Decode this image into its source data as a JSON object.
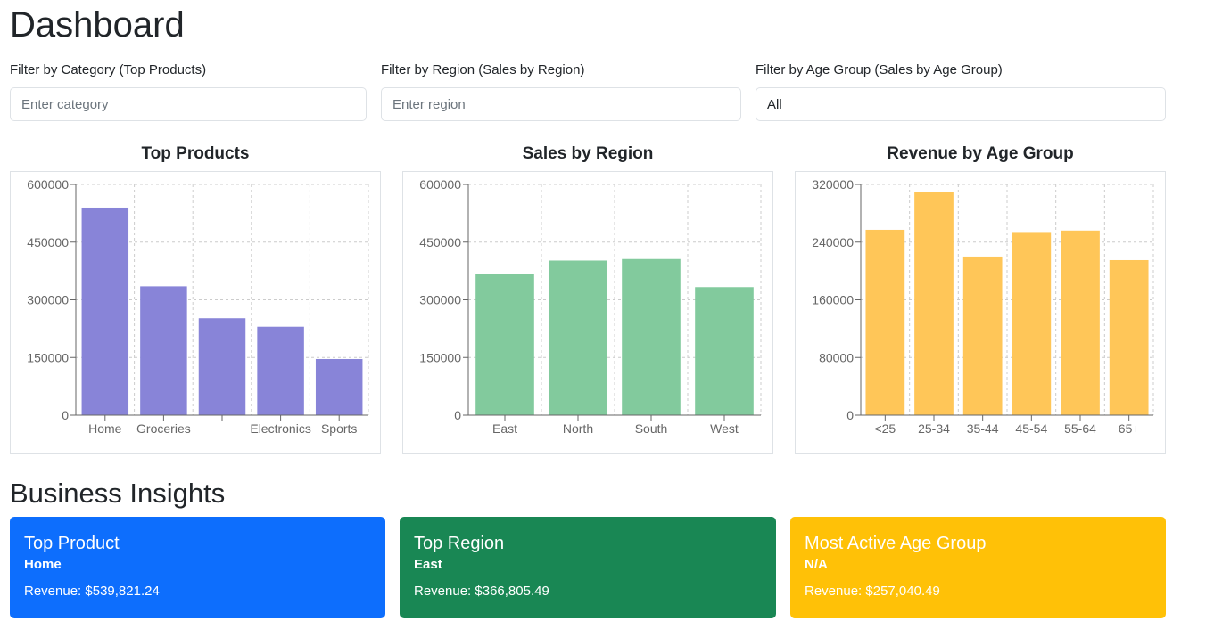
{
  "page": {
    "title": "Dashboard"
  },
  "filters": {
    "category": {
      "label": "Filter by Category (Top Products)",
      "placeholder": "Enter category",
      "value": ""
    },
    "region": {
      "label": "Filter by Region (Sales by Region)",
      "placeholder": "Enter region",
      "value": ""
    },
    "age_group": {
      "label": "Filter by Age Group (Sales by Age Group)",
      "value": "All"
    }
  },
  "colors": {
    "products": "#8884d8",
    "regions": "#82ca9d",
    "age": "#ffc658",
    "card_product": "#0d6efd",
    "card_region": "#198754",
    "card_age": "#ffc107"
  },
  "chart_data": [
    {
      "type": "bar",
      "title": "Top Products",
      "categories": [
        "Home",
        "Groceries",
        "",
        "Electronics",
        "Sports"
      ],
      "values": [
        539821.24,
        335000,
        252000,
        230000,
        146000
      ],
      "ylim": [
        0,
        600000
      ],
      "yticks": [
        0,
        150000,
        300000,
        450000,
        600000
      ],
      "grid": true,
      "color": "#8884d8"
    },
    {
      "type": "bar",
      "title": "Sales by Region",
      "categories": [
        "East",
        "North",
        "South",
        "West"
      ],
      "values": [
        366805.49,
        402000,
        406000,
        333000
      ],
      "ylim": [
        0,
        600000
      ],
      "yticks": [
        0,
        150000,
        300000,
        450000,
        600000
      ],
      "grid": true,
      "color": "#82ca9d"
    },
    {
      "type": "bar",
      "title": "Revenue by Age Group",
      "categories": [
        "<25",
        "25-34",
        "35-44",
        "45-54",
        "55-64",
        "65+"
      ],
      "values": [
        257040.49,
        309000,
        220000,
        254000,
        256000,
        215000
      ],
      "ylim": [
        0,
        320000
      ],
      "yticks": [
        0,
        80000,
        160000,
        240000,
        320000
      ],
      "grid": true,
      "color": "#ffc658"
    }
  ],
  "insights": {
    "title": "Business Insights",
    "cards": [
      {
        "title": "Top Product",
        "subtitle": "Home",
        "revenue": "Revenue: $539,821.24"
      },
      {
        "title": "Top Region",
        "subtitle": "East",
        "revenue": "Revenue: $366,805.49"
      },
      {
        "title": "Most Active Age Group",
        "subtitle": "N/A",
        "revenue": "Revenue: $257,040.49"
      }
    ]
  }
}
